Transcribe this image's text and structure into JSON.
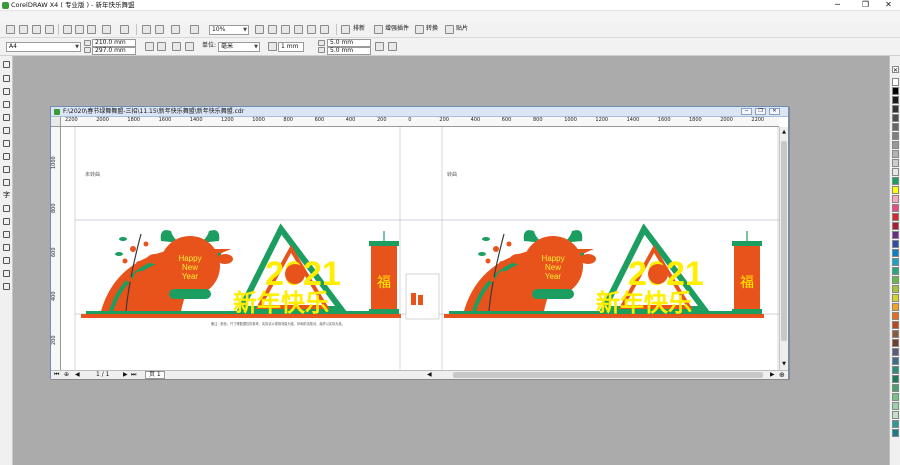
{
  "window": {
    "title": "CorelDRAW X4 ( 专业版 ) - 新年快乐舞盟",
    "min": "─",
    "max": "❐",
    "close": "✕"
  },
  "toolbar": {
    "zoom": "10%",
    "labels": {
      "import": "排新",
      "text": "增强插件",
      "convert": "转换",
      "paste": "贴片"
    }
  },
  "property_bar": {
    "paper": "A4",
    "width": "210.0 mm",
    "height": "297.0 mm",
    "units_label": "单位:",
    "units": "毫米",
    "nudge": "1 mm",
    "dup_x": "5.0 mm",
    "dup_y": "5.0 mm"
  },
  "document": {
    "title": "F:\\2020\\春节绿舞舞盟-三招\\11.15\\新年快乐舞盟\\新年快乐舞盟.cdr",
    "ruler_labels": [
      "2200",
      "2000",
      "1800",
      "1600",
      "1400",
      "1200",
      "1000",
      "800",
      "600",
      "400",
      "200",
      "0",
      "200",
      "400",
      "600",
      "800",
      "1000",
      "1200",
      "1400",
      "1600",
      "1800",
      "2000",
      "2200"
    ],
    "vruler_labels": [
      "1000",
      "800",
      "600",
      "400",
      "200"
    ],
    "panel_left_label": "未转曲",
    "panel_right_label": "转曲",
    "caption": "备注：颜色、尺寸等数据仅供参考，实际请以现场测量为准，印刷前请核对，最终以实际为准。",
    "artwork": {
      "year": "2021",
      "slogan": "新年快乐",
      "greeting": [
        "Happy",
        "New",
        "Year"
      ],
      "fu": "福"
    }
  },
  "statusbar": {
    "page_counter": "1 / 1",
    "page_tab": "页 1"
  },
  "palette": [
    "#ffffff",
    "#000000",
    "#1a1a1a",
    "#333333",
    "#4d4d4d",
    "#666666",
    "#808080",
    "#999999",
    "#b3b3b3",
    "#cccccc",
    "#e6e6e6",
    "#1b9e5f",
    "#ffff00",
    "#f7a8c0",
    "#e84b8a",
    "#d12a2a",
    "#a82030",
    "#6b2c88",
    "#2d4fa3",
    "#0a7fc1",
    "#19a3c9",
    "#22aa7a",
    "#64b94b",
    "#a6c23b",
    "#d9d325",
    "#f0a323",
    "#e86b1e",
    "#b54a1c",
    "#8a5a3a",
    "#6e3e2a",
    "#5a5a80",
    "#3a6f8a",
    "#2a8f7a",
    "#1f7a5a",
    "#4aa06a",
    "#7ac08a",
    "#9ad0aa",
    "#c0e0c8",
    "#2a9a9a",
    "#1a7a8a"
  ]
}
